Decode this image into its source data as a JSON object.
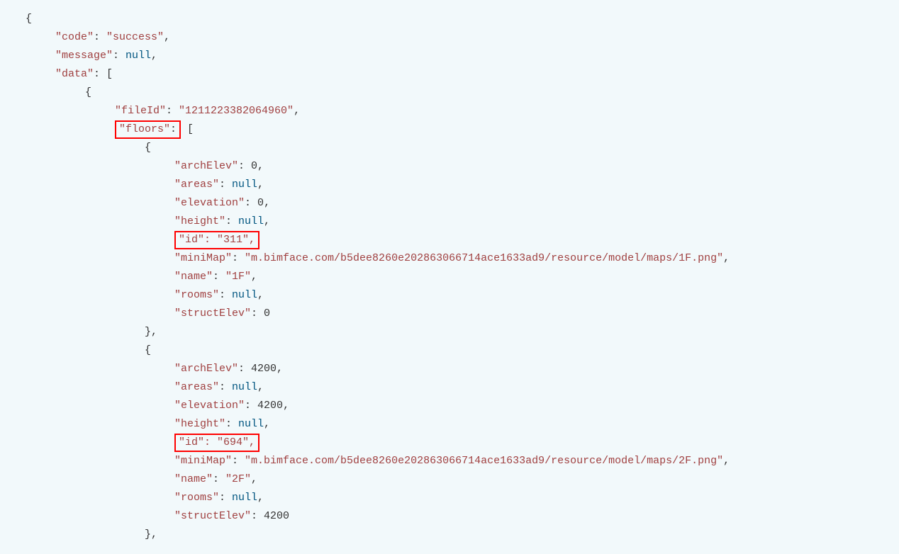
{
  "json": {
    "code_key": "\"code\"",
    "code_val": "\"success\"",
    "message_key": "\"message\"",
    "message_val": "null",
    "data_key": "\"data\"",
    "fileId_key": "\"fileId\"",
    "fileId_val": "\"1211223382064960\"",
    "floors_key": "\"floors\"",
    "floor1": {
      "archElev_key": "\"archElev\"",
      "archElev_val": "0",
      "areas_key": "\"areas\"",
      "areas_val": "null",
      "elevation_key": "\"elevation\"",
      "elevation_val": "0",
      "height_key": "\"height\"",
      "height_val": "null",
      "id_chunk": "\"id\": \"311\",",
      "miniMap_key": "\"miniMap\"",
      "miniMap_val": "\"m.bimface.com/b5dee8260e202863066714ace1633ad9/resource/model/maps/1F.png\"",
      "name_key": "\"name\"",
      "name_val": "\"1F\"",
      "rooms_key": "\"rooms\"",
      "rooms_val": "null",
      "structElev_key": "\"structElev\"",
      "structElev_val": "0"
    },
    "floor2": {
      "archElev_key": "\"archElev\"",
      "archElev_val": "4200",
      "areas_key": "\"areas\"",
      "areas_val": "null",
      "elevation_key": "\"elevation\"",
      "elevation_val": "4200",
      "height_key": "\"height\"",
      "height_val": "null",
      "id_chunk": "\"id\": \"694\",",
      "miniMap_key": "\"miniMap\"",
      "miniMap_val": "\"m.bimface.com/b5dee8260e202863066714ace1633ad9/resource/model/maps/2F.png\"",
      "name_key": "\"name\"",
      "name_val": "\"2F\"",
      "rooms_key": "\"rooms\"",
      "rooms_val": "null",
      "structElev_key": "\"structElev\"",
      "structElev_val": "4200"
    }
  }
}
